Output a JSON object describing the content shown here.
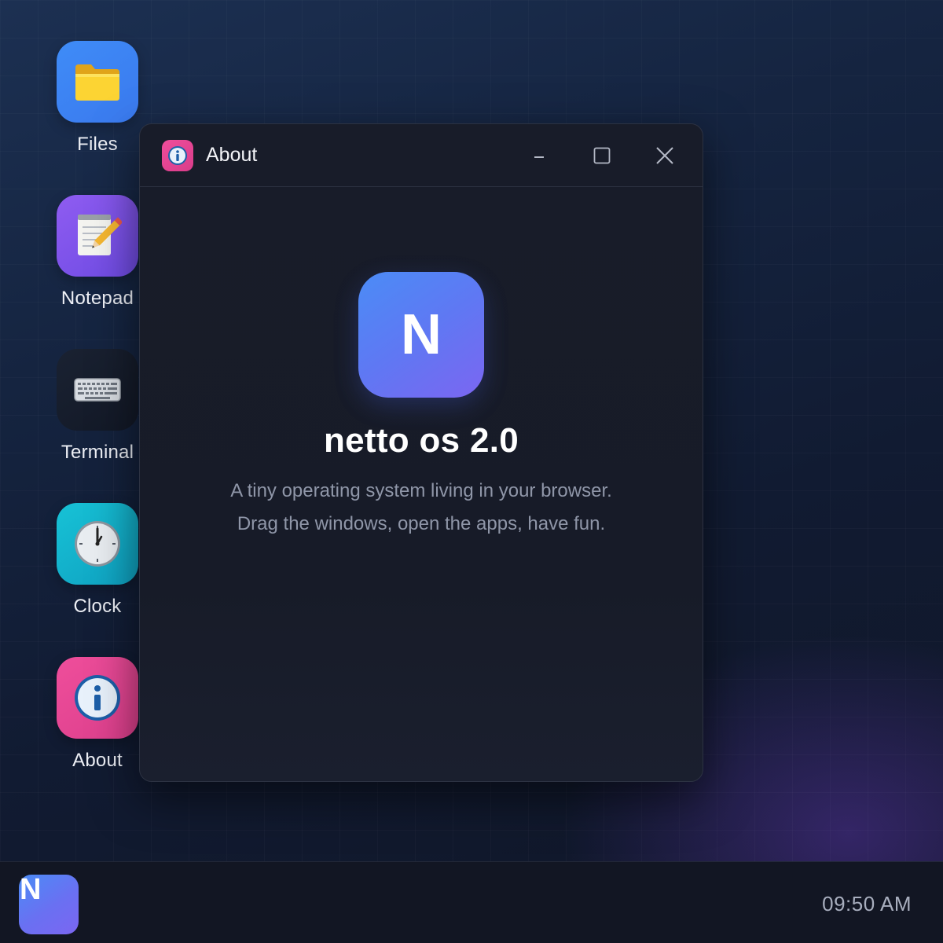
{
  "desktop": {
    "icons": [
      {
        "label": "Files",
        "icon": "folder-icon"
      },
      {
        "label": "Notepad",
        "icon": "notepad-icon"
      },
      {
        "label": "Terminal",
        "icon": "keyboard-icon"
      },
      {
        "label": "Clock",
        "icon": "clock-icon"
      },
      {
        "label": "About",
        "icon": "info-icon"
      }
    ]
  },
  "window": {
    "title": "About",
    "title_icon": "info-icon",
    "controls": [
      "minimize-icon",
      "maximize-icon",
      "close-icon"
    ],
    "logo_letter": "N",
    "product_name": "netto os 2.0",
    "description_line1": "A tiny operating system living in your browser.",
    "description_line2": "Drag the windows, open the apps, have fun."
  },
  "taskbar": {
    "start_letter": "N",
    "clock": "09:50 AM"
  },
  "colors": {
    "files": "#3f8cf7",
    "notepad": "#8f5cf1",
    "clock": "#17c2d6",
    "about": "#ef4e9b",
    "brand_start": "#4b8cf6",
    "brand_end": "#7b66f1"
  }
}
